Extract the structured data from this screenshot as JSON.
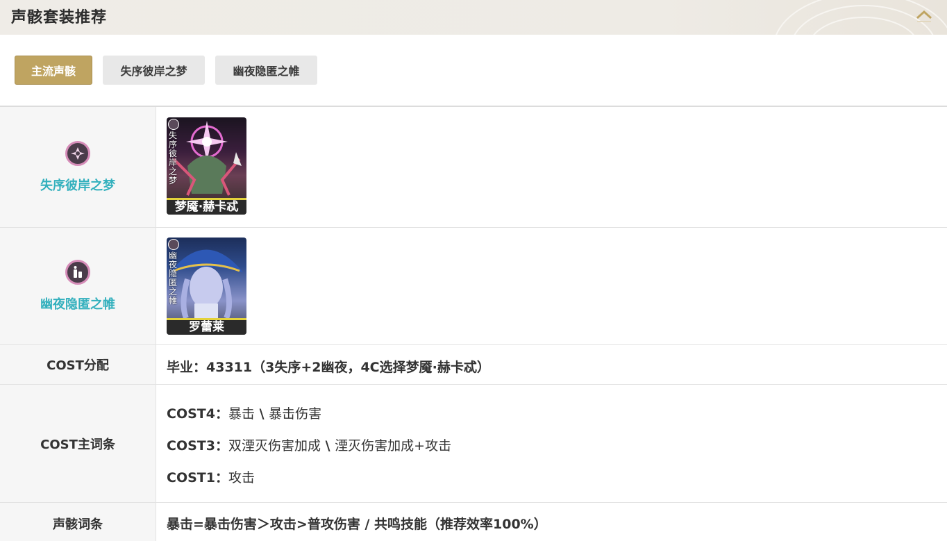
{
  "header": {
    "title": "声骸套装推荐",
    "collapse_icon": "chevron-up-icon"
  },
  "tabs": [
    {
      "label": "主流声骸",
      "active": true
    },
    {
      "label": "失序彼岸之梦",
      "active": false
    },
    {
      "label": "幽夜隐匿之帷",
      "active": false
    }
  ],
  "rows": {
    "set1": {
      "label": "失序彼岸之梦",
      "icon": "disorder-set-icon",
      "card": {
        "name": "梦魇·赫卡忒",
        "vertical_text": "失序彼岸之梦"
      }
    },
    "set2": {
      "label": "幽夜隐匿之帷",
      "icon": "night-veil-set-icon",
      "card": {
        "name": "罗蕾莱",
        "vertical_text": "幽夜隐匿之帷"
      }
    },
    "cost_alloc": {
      "label": "COST分配",
      "value": "毕业：43311（3失序+2幽夜，4C选择梦魇·赫卡忒）"
    },
    "cost_main": {
      "label": "COST主词条",
      "lines": [
        {
          "key": "COST4：",
          "value": "暴击",
          "sep": " \\ ",
          "value2": "暴击伤害"
        },
        {
          "key": "COST3：",
          "value": "双湮灭伤害加成",
          "sep": " \\ ",
          "value2": "湮灭伤害加成+攻击"
        },
        {
          "key": "COST1：",
          "value": "攻击",
          "sep": "",
          "value2": ""
        }
      ]
    },
    "substats": {
      "label": "声骸词条",
      "value": "暴击=暴击伤害＞攻击>普攻伤害 / 共鸣技能（推荐效率100%）"
    }
  },
  "colors": {
    "accent_gold": "#bfa461",
    "teal": "#33b0bd",
    "card_bar": "#e3d23b"
  }
}
